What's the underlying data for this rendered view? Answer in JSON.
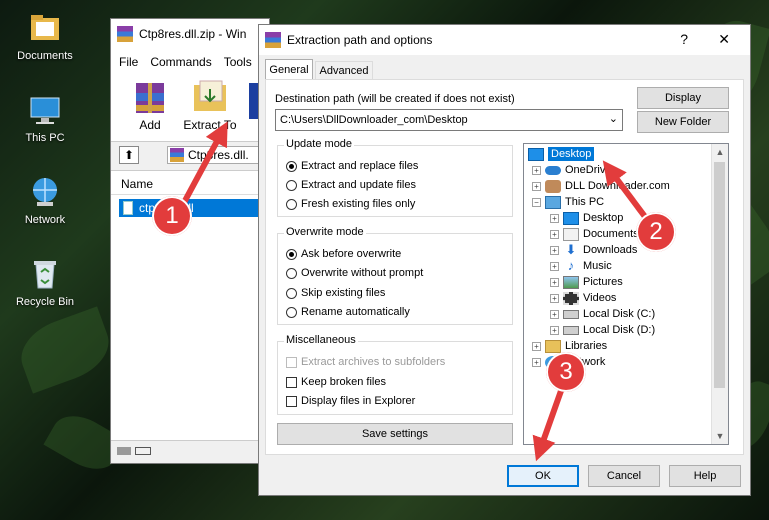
{
  "desktop": {
    "icons": [
      {
        "label": "Documents"
      },
      {
        "label": "This PC"
      },
      {
        "label": "Network"
      },
      {
        "label": "Recycle Bin"
      }
    ]
  },
  "winrar": {
    "title": "Ctp8res.dll.zip - Win",
    "menu": [
      "File",
      "Commands",
      "Tools"
    ],
    "toolbar": {
      "add": "Add",
      "extract_to": "Extract To"
    },
    "path": "Ctp8res.dll.",
    "column_name": "Name",
    "selected_file": "ctp8res.dll"
  },
  "dialog": {
    "title": "Extraction path and options",
    "help_glyph": "?",
    "close_glyph": "✕",
    "tabs": [
      "General",
      "Advanced"
    ],
    "dest_label": "Destination path (will be created if does not exist)",
    "dest_value": "C:\\Users\\DllDownloader_com\\Desktop",
    "display_btn": "Display",
    "new_folder_btn": "New Folder",
    "update_mode": {
      "title": "Update mode",
      "options": [
        "Extract and replace files",
        "Extract and update files",
        "Fresh existing files only"
      ],
      "selected": 0
    },
    "overwrite_mode": {
      "title": "Overwrite mode",
      "options": [
        "Ask before overwrite",
        "Overwrite without prompt",
        "Skip existing files",
        "Rename automatically"
      ],
      "selected": 0
    },
    "misc": {
      "title": "Miscellaneous",
      "options": [
        "Extract archives to subfolders",
        "Keep broken files",
        "Display files in Explorer"
      ]
    },
    "save_settings": "Save settings",
    "tree": [
      {
        "label": "Desktop"
      },
      {
        "label": "OneDrive"
      },
      {
        "label": "DLL Downloader.com"
      },
      {
        "label": "This PC"
      },
      {
        "label": "Desktop"
      },
      {
        "label": "Documents"
      },
      {
        "label": "Downloads"
      },
      {
        "label": "Music"
      },
      {
        "label": "Pictures"
      },
      {
        "label": "Videos"
      },
      {
        "label": "Local Disk (C:)"
      },
      {
        "label": "Local Disk (D:)"
      },
      {
        "label": "Libraries"
      },
      {
        "label": "Network"
      }
    ],
    "ok": "OK",
    "cancel": "Cancel",
    "help": "Help"
  },
  "callouts": [
    "1",
    "2",
    "3"
  ],
  "colors": {
    "callout": "#e23c3c",
    "selection": "#0078d7",
    "ok_border": "#0078d7"
  }
}
